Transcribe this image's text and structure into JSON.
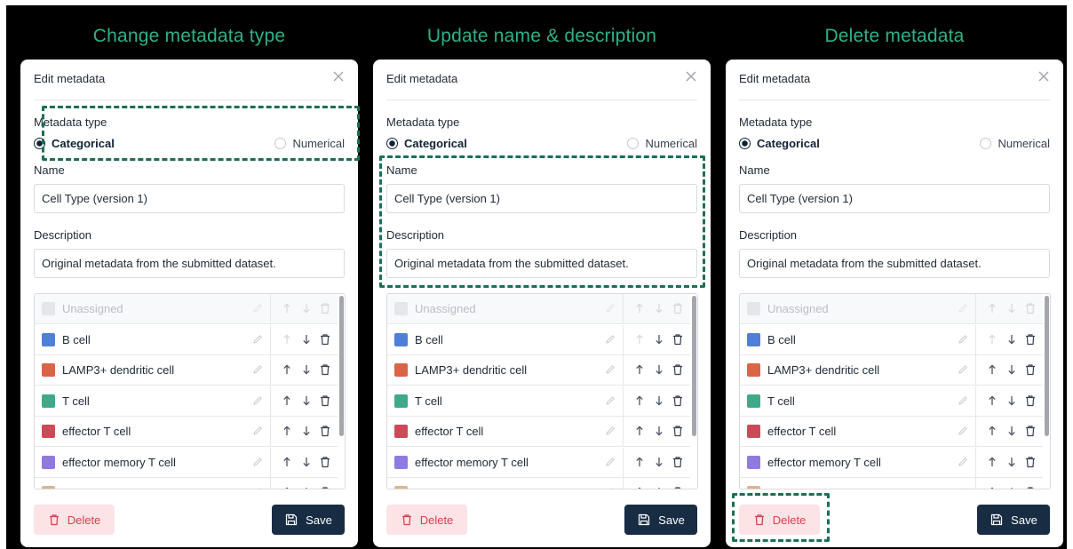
{
  "panels": [
    {
      "heading": "Change metadata type",
      "dialog_title": "Edit metadata",
      "metadata_type_label": "Metadata type",
      "radio_categorical": "Categorical",
      "radio_numerical": "Numerical",
      "selected_type": "Categorical",
      "name_label": "Name",
      "name_value": "Cell Type (version 1)",
      "description_label": "Description",
      "description_value": "Original metadata from the submitted dataset.",
      "delete_label": "Delete",
      "save_label": "Save"
    },
    {
      "heading": "Update name & description",
      "dialog_title": "Edit metadata",
      "metadata_type_label": "Metadata type",
      "radio_categorical": "Categorical",
      "radio_numerical": "Numerical",
      "selected_type": "Categorical",
      "name_label": "Name",
      "name_value": "Cell Type (version 1)",
      "description_label": "Description",
      "description_value": "Original metadata from the submitted dataset.",
      "delete_label": "Delete",
      "save_label": "Save"
    },
    {
      "heading": "Delete metadata",
      "dialog_title": "Edit metadata",
      "metadata_type_label": "Metadata type",
      "radio_categorical": "Categorical",
      "radio_numerical": "Numerical",
      "selected_type": "Categorical",
      "name_label": "Name",
      "name_value": "Cell Type (version 1)",
      "description_label": "Description",
      "description_value": "Original metadata from the submitted dataset.",
      "delete_label": "Delete",
      "save_label": "Save"
    }
  ],
  "categories": [
    {
      "label": "Unassigned",
      "color": "#e4e6e9",
      "disabled": true
    },
    {
      "label": "B cell",
      "color": "#4f7fd6",
      "disabled": false
    },
    {
      "label": "LAMP3+ dendritic cell",
      "color": "#d96446",
      "disabled": false
    },
    {
      "label": "T cell",
      "color": "#3fa98a",
      "disabled": false
    },
    {
      "label": "effector T cell",
      "color": "#cc4a57",
      "disabled": false
    },
    {
      "label": "effector memory T cell",
      "color": "#8f7adf",
      "disabled": false
    },
    {
      "label": "",
      "color": "#dcb58e",
      "disabled": false
    }
  ],
  "icons": {
    "close": "close-icon",
    "pencil": "pencil-icon",
    "up": "arrow-up-icon",
    "down": "arrow-down-icon",
    "trash": "trash-icon",
    "save": "floppy-disk-icon"
  },
  "colors": {
    "heading": "#2fb089",
    "highlight": "#1d6f51",
    "save_bg": "#182c44",
    "delete_bg": "#fbe3e6",
    "delete_text": "#d7404f"
  }
}
